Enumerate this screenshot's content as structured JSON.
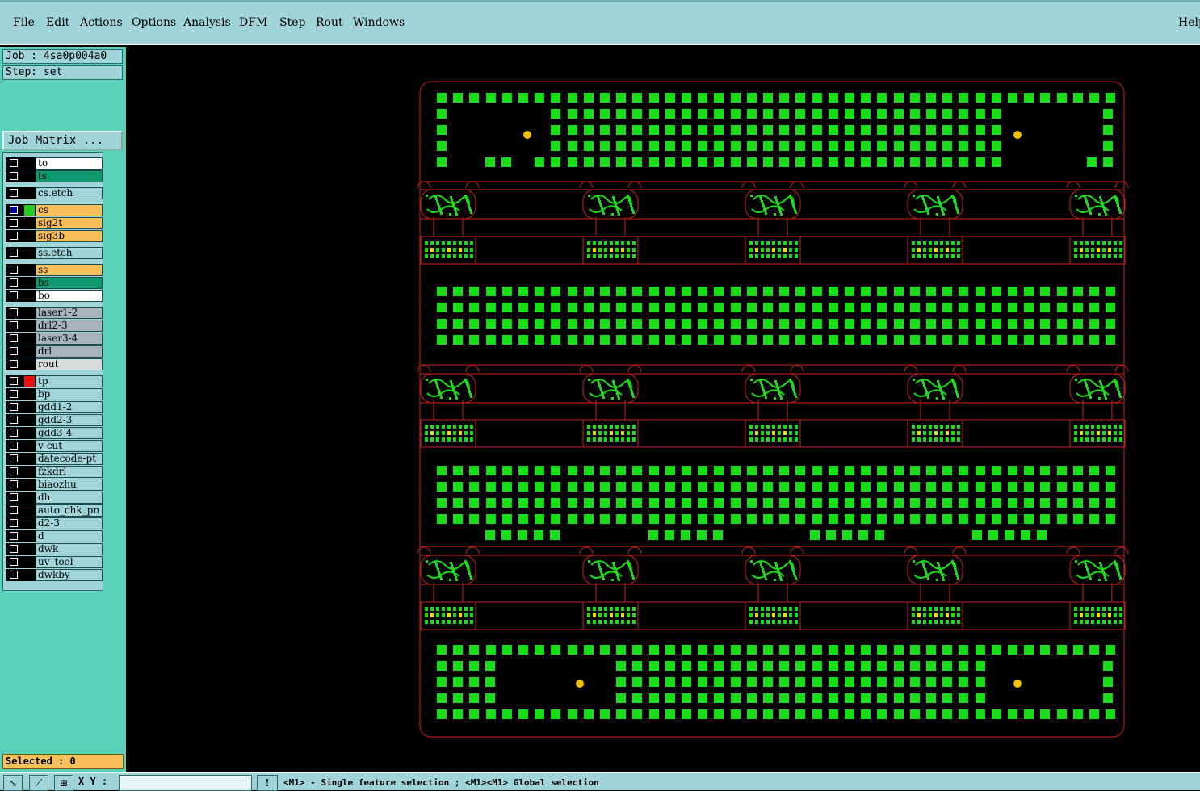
{
  "menubar": {
    "items": [
      {
        "label": "File",
        "underline": "F"
      },
      {
        "label": "Edit",
        "underline": "E"
      },
      {
        "label": "Actions",
        "underline": "A"
      },
      {
        "label": "Options",
        "underline": "O"
      },
      {
        "label": "Analysis",
        "underline": "A"
      },
      {
        "label": "DFM",
        "underline": "D"
      },
      {
        "label": "Step",
        "underline": "S"
      },
      {
        "label": "Rout",
        "underline": "R"
      },
      {
        "label": "Windows",
        "underline": "W"
      }
    ],
    "help_label": "Help"
  },
  "panel": {
    "job_line": "Job : 4sa0p004a0",
    "step_line": "Step: set",
    "job_matrix_button": "Job Matrix ..."
  },
  "layers": [
    {
      "name": "to",
      "color": "#ffffff",
      "swatch": "",
      "group": 0
    },
    {
      "name": "ts",
      "color": "#0e9a6e",
      "swatch": "",
      "group": 0
    },
    {
      "name": "cs.etch",
      "color": "#9fd4d8",
      "swatch": "",
      "group": 1
    },
    {
      "name": "cs",
      "color": "#f7c05a",
      "swatch": "#22cc22",
      "group": 2,
      "active": true
    },
    {
      "name": "sig2t",
      "color": "#f7c05a",
      "swatch": "",
      "group": 2
    },
    {
      "name": "sig3b",
      "color": "#f7c05a",
      "swatch": "",
      "group": 2
    },
    {
      "name": "ss.etch",
      "color": "#9fd4d8",
      "swatch": "",
      "group": 3
    },
    {
      "name": "ss",
      "color": "#f7c05a",
      "swatch": "",
      "group": 4
    },
    {
      "name": "bs",
      "color": "#0e9a6e",
      "swatch": "",
      "group": 4
    },
    {
      "name": "bo",
      "color": "#ffffff",
      "swatch": "",
      "group": 4
    },
    {
      "name": "laser1-2",
      "color": "#a8b4bc",
      "swatch": "",
      "group": 5
    },
    {
      "name": "drl2-3",
      "color": "#a8b4bc",
      "swatch": "",
      "group": 5
    },
    {
      "name": "laser3-4",
      "color": "#a8b4bc",
      "swatch": "",
      "group": 5
    },
    {
      "name": "drl",
      "color": "#a8b4bc",
      "swatch": "",
      "group": 5
    },
    {
      "name": "rout",
      "color": "#d9dcdc",
      "swatch": "",
      "group": 5
    },
    {
      "name": "tp",
      "color": "#9fd4d8",
      "swatch": "#e81010",
      "group": 6
    },
    {
      "name": "bp",
      "color": "#9fd4d8",
      "swatch": "",
      "group": 6
    },
    {
      "name": "gdd1-2",
      "color": "#9fd4d8",
      "swatch": "",
      "group": 6
    },
    {
      "name": "gdd2-3",
      "color": "#9fd4d8",
      "swatch": "",
      "group": 6
    },
    {
      "name": "gdd3-4",
      "color": "#9fd4d8",
      "swatch": "",
      "group": 6
    },
    {
      "name": "v-cut",
      "color": "#9fd4d8",
      "swatch": "",
      "group": 6
    },
    {
      "name": "datecode-pt",
      "color": "#9fd4d8",
      "swatch": "",
      "group": 6
    },
    {
      "name": "fzkdrl",
      "color": "#9fd4d8",
      "swatch": "",
      "group": 6
    },
    {
      "name": "biaozhu",
      "color": "#9fd4d8",
      "swatch": "",
      "group": 6
    },
    {
      "name": "dh",
      "color": "#9fd4d8",
      "swatch": "",
      "group": 6
    },
    {
      "name": "auto_chk_pn",
      "color": "#9fd4d8",
      "swatch": "",
      "group": 6
    },
    {
      "name": "d2-3",
      "color": "#9fd4d8",
      "swatch": "",
      "group": 6
    },
    {
      "name": "d",
      "color": "#9fd4d8",
      "swatch": "",
      "group": 6
    },
    {
      "name": "dwk",
      "color": "#9fd4d8",
      "swatch": "",
      "group": 6
    },
    {
      "name": "uv_tool",
      "color": "#9fd4d8",
      "swatch": "",
      "group": 6
    },
    {
      "name": "dwkby",
      "color": "#9fd4d8",
      "swatch": "",
      "group": 6
    }
  ],
  "selected_line": "Selected : 0",
  "statusbar": {
    "xy_label": "X Y :",
    "xy_value": "",
    "hint": "<M1> - Single feature selection ; <M1><M1> Global selection"
  },
  "colors": {
    "pad": "#19dd19",
    "outline": "#cc1f1f",
    "fiducial": "#f2c200",
    "component": "#e8e000"
  }
}
